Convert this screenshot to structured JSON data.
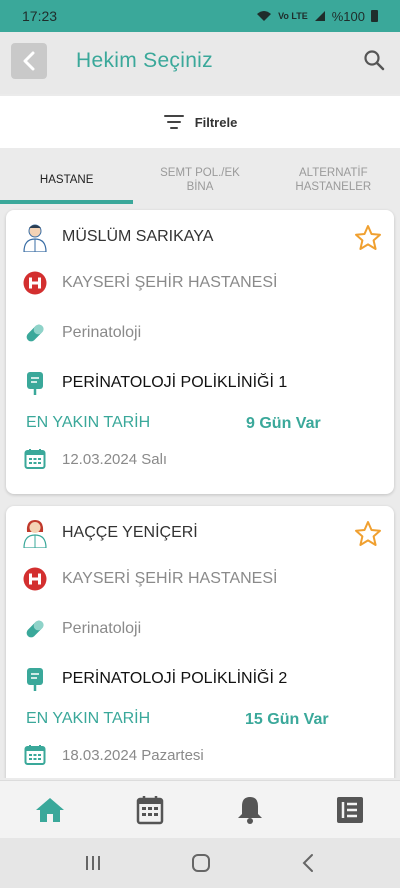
{
  "status_bar": {
    "time": "17:23",
    "signal": "Vo LTE",
    "battery": "%100"
  },
  "header": {
    "title": "Hekim Seçiniz"
  },
  "filter": {
    "label": "Filtrele"
  },
  "tabs": [
    {
      "label": "HASTANE",
      "active": true
    },
    {
      "label": "SEMT POL./EK BİNA",
      "active": false
    },
    {
      "label": "ALTERNATİF HASTANELER",
      "active": false
    }
  ],
  "cards": [
    {
      "doctor": "MÜSLÜM SARIKAYA",
      "hospital": "KAYSERİ ŞEHİR HASTANESİ",
      "specialty": "Perinatoloji",
      "clinic": "PERİNATOLOJİ POLİKLİNİĞİ 1",
      "nearest_label": "EN YAKIN TARİH",
      "days": "9 Gün Var",
      "date": "12.03.2024 Salı",
      "gender": "male"
    },
    {
      "doctor": "HAÇÇE YENİÇERİ",
      "hospital": "KAYSERİ ŞEHİR HASTANESİ",
      "specialty": "Perinatoloji",
      "clinic": "PERİNATOLOJİ POLİKLİNİĞİ 2",
      "nearest_label": "EN YAKIN TARİH",
      "days": "15 Gün Var",
      "date": "18.03.2024 Pazartesi",
      "gender": "female"
    }
  ],
  "colors": {
    "accent": "#3aa89a",
    "star": "#f0a030",
    "hospital_icon": "#d32f2f"
  },
  "bottom_nav": [
    "home-icon",
    "calendar-icon",
    "bell-icon",
    "list-icon"
  ]
}
